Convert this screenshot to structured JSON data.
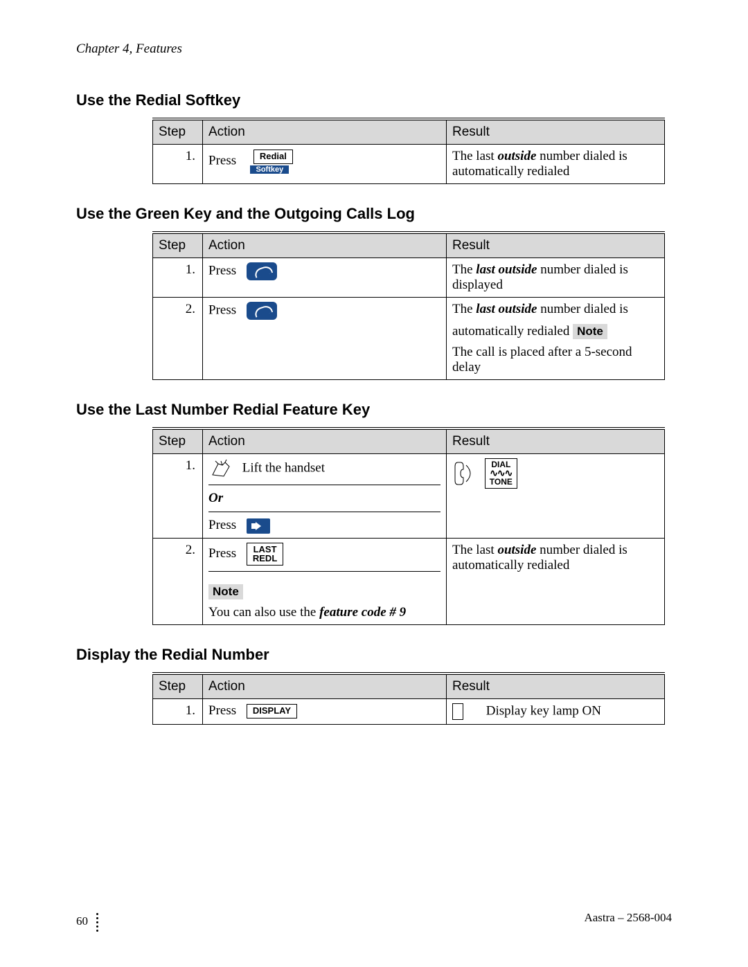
{
  "header": {
    "chapter": "Chapter 4, Features"
  },
  "labels": {
    "step": "Step",
    "action": "Action",
    "result": "Result",
    "press": "Press",
    "or": "Or",
    "note": "Note"
  },
  "buttons": {
    "redial": "Redial",
    "softkey": "Softkey",
    "last_redl_l1": "LAST",
    "last_redl_l2": "REDL",
    "display": "DISPLAY",
    "dial": "DIAL",
    "tone": "TONE",
    "wave": "∿∿∿"
  },
  "sections": {
    "s1": {
      "title": "Use the Redial Softkey",
      "rows": [
        {
          "step": "1.",
          "result_pre": "The last ",
          "result_em": "outside",
          "result_post": " number dialed is automatically redialed"
        }
      ]
    },
    "s2": {
      "title": "Use the Green Key and the Outgoing Calls Log",
      "rows": [
        {
          "step": "1.",
          "result_pre": "The ",
          "result_em": "last outside",
          "result_post": " number dialed is displayed"
        },
        {
          "step": "2.",
          "result_pre": "The ",
          "result_em": "last outside",
          "result_post": " number dialed is automatically redialed",
          "note_text": "The call is placed after a 5-second delay"
        }
      ]
    },
    "s3": {
      "title": "Use the Last Number Redial Feature Key",
      "rows": [
        {
          "step": "1.",
          "lift": "Lift the handset"
        },
        {
          "step": "2.",
          "result_pre": "The last ",
          "result_em": "outside",
          "result_post": " number dialed is automatically redialed",
          "action_note_pre": "You can also use the ",
          "action_note_em": "feature code # 9"
        }
      ]
    },
    "s4": {
      "title": "Display the Redial Number",
      "rows": [
        {
          "step": "1.",
          "result": "Display key lamp ON"
        }
      ]
    }
  },
  "footer": {
    "page": "60",
    "right": "Aastra – 2568-004"
  }
}
